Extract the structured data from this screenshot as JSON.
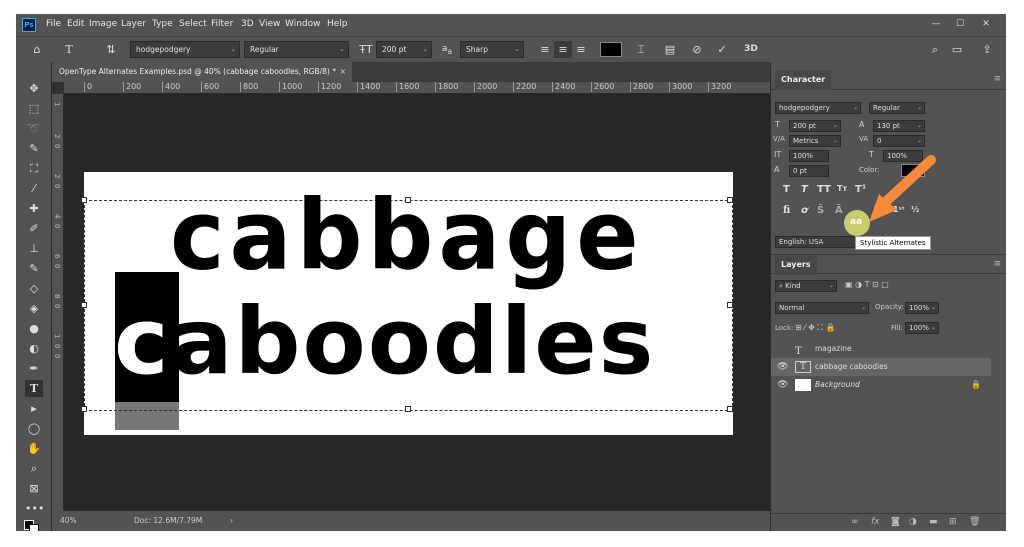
{
  "menu": [
    "File",
    "Edit",
    "Image",
    "Layer",
    "Type",
    "Select",
    "Filter",
    "3D",
    "View",
    "Window",
    "Help"
  ],
  "app_badge": "Ps",
  "options": {
    "font_family": "hodgepodgery",
    "font_style": "Regular",
    "font_size": "200 pt",
    "aa_label": "a",
    "aa_sub": "a",
    "antialias": "Sharp",
    "threed": "3D"
  },
  "doc_tab": {
    "title": "OpenType Alternates Examples.psd @ 40% (cabbage caboodles, RGB/8) *",
    "close": "×"
  },
  "ruler_h": [
    "0",
    "200",
    "400",
    "600",
    "800",
    "1000",
    "1200",
    "1400",
    "1600",
    "1800",
    "2000",
    "2200",
    "2400",
    "2600",
    "2800",
    "3000",
    "3200"
  ],
  "ruler_v": [
    "1",
    "2",
    "0",
    "2",
    "0",
    "4",
    "0",
    "6",
    "0",
    "8",
    "0",
    "1",
    "0",
    "0"
  ],
  "canvas_text": {
    "line1": "cabbage",
    "line2_first": "c",
    "line2_rest": "aboodles"
  },
  "status": {
    "zoom": "40%",
    "doc": "Doc: 12.6M/7.79M",
    "arrow": "›"
  },
  "character_panel": {
    "title": "Character",
    "font_family": "hodgepodgery",
    "font_style": "Regular",
    "size": "200 pt",
    "leading": "130 pt",
    "kerning": "Metrics",
    "tracking": "0",
    "vscale": "100%",
    "hscale": "100%",
    "baseline": "0 pt",
    "color_label": "Color:",
    "language": "English: USA",
    "tooltip": "Stylistic Alternates",
    "highlight": "aa",
    "labels": {
      "size": "T",
      "leading": "A",
      "kern": "V/A",
      "track": "VA",
      "vscale": "IT",
      "hscale": "T",
      "baseline": "A"
    }
  },
  "layers_panel": {
    "title": "Layers",
    "kind": "Kind",
    "blend": "Normal",
    "opacity_label": "Opacity:",
    "opacity": "100%",
    "lock_label": "Lock:",
    "fill_label": "Fill:",
    "fill": "100%",
    "layers": [
      {
        "name": "magazine",
        "type": "T"
      },
      {
        "name": "cabbage caboodles",
        "type": "T"
      },
      {
        "name": "Background",
        "type": "bg"
      }
    ]
  }
}
